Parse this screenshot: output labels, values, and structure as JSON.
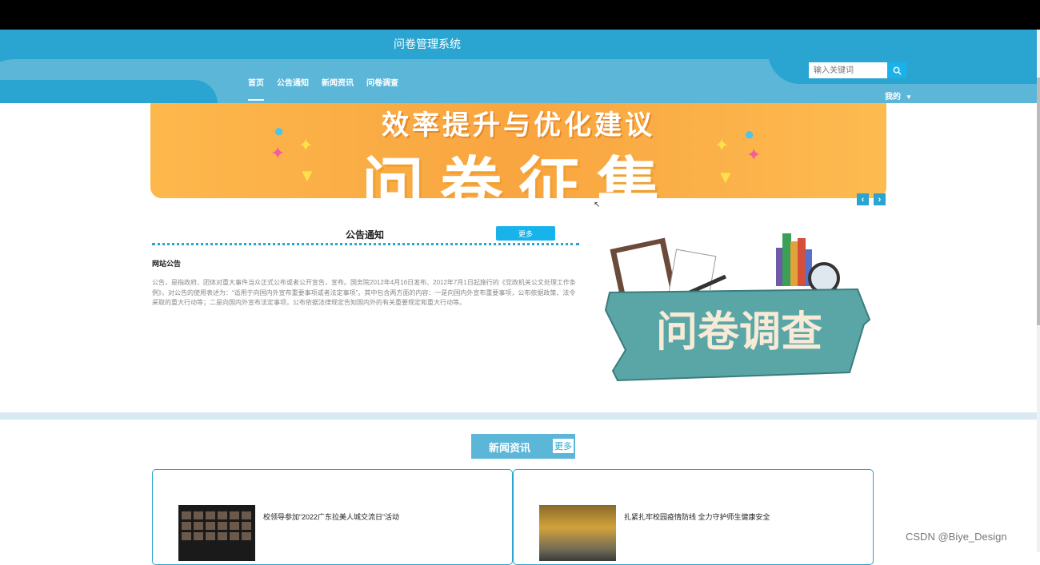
{
  "header": {
    "site_title": "问卷管理系统",
    "nav": [
      "首页",
      "公告通知",
      "新闻资讯",
      "问卷调查"
    ],
    "search_placeholder": "输入关键词",
    "mine": "我的"
  },
  "banner": {
    "subtitle": "效率提升与优化建议",
    "main": "问卷征集"
  },
  "notice": {
    "title": "公告通知",
    "more": "更多",
    "subtitle": "网站公告",
    "body": "公告，是指政府、团体对重大事件当众正式公布或者公开宣告，宣布。国务院2012年4月16日发布、2012年7月1日起施行的《党政机关公文处理工作条例》，对公告的使用表述为：“适用于向国内外宣布重要事项或者法定事项”。其中包含两方面的内容：一是向国内外宣布重要事项，公布依据政策、法令采取的重大行动等；二是向国内外宣布法定事项，公布依据法律规定告知国内外的有关重要规定和重大行动等。"
  },
  "survey_image_text": "问卷调查",
  "news": {
    "title": "新闻资讯",
    "more": "更多",
    "items": [
      {
        "title": "校领导参加“2022广东拉美人城交流日”活动"
      },
      {
        "title": "扎紧扎牢校园疫情防线 全力守护师生健康安全"
      }
    ]
  },
  "watermark": "CSDN @Biye_Design",
  "colors": {
    "primary": "#2aa4d0",
    "light": "#5bb6d8",
    "accent": "#18b3ea",
    "banner": "#fbb04a"
  }
}
